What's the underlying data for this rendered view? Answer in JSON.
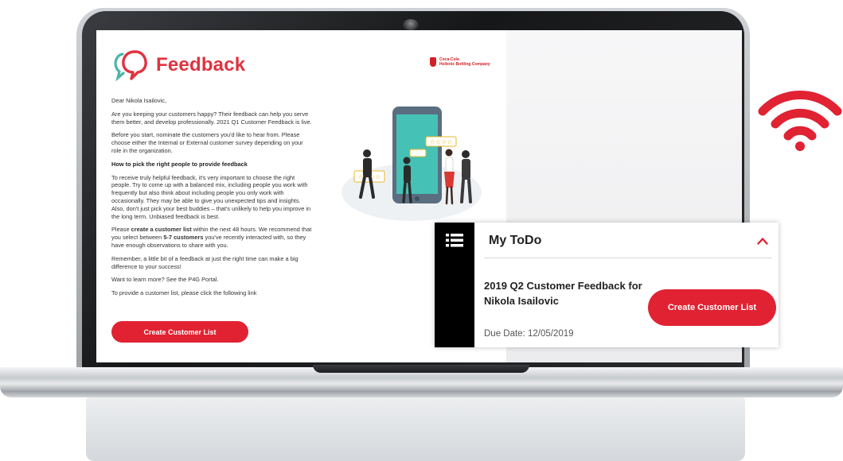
{
  "colors": {
    "brand_red": "#e02232",
    "logo_teal": "#4bb6a8",
    "sidebar_black": "#000000"
  },
  "email": {
    "brand_name": "Feedback",
    "brand_icon": "speech-bubbles-icon",
    "company": {
      "line1": "Coca-Cola",
      "line2": "Hellenic Bottling Company"
    },
    "greeting": "Dear Nikola Isailovic,",
    "paragraph1": "Are you keeping your customers happy? Their feedback can help you serve them better, and develop professionally. 2021 Q1 Customer Feedback is live.",
    "paragraph2": "Before you start, nominate the customers you'd like to hear from. Please choose either the Internal or External customer survey depending on your role in the organization.",
    "heading": "How to pick the right people to provide feedback",
    "paragraph3": "To receive truly helpful feedback, it's very important to choose the right people. Try to come up with a balanced mix, including people you work with frequently but also think about including people you only work with occasionally. They may be able to give you unexpected tips and insights. Also, don't just pick your best buddies – that's unlikely to help you improve in the long term. Unbiased feedback is best.",
    "paragraph4": {
      "part1": "Please ",
      "bold1": "create a customer list",
      "part2": " within the next 48 hours. We recommend that you select between ",
      "bold2": "5-7 customers",
      "part3": " you've recently interacted with, so they have enough observations to share with you."
    },
    "paragraph5": "Remember, a little bit of a feedback at just the right time can make a big difference to your success!",
    "paragraph6": "Want to learn more? See the P4G Portal.",
    "paragraph7": "To provide a customer list, please click the following link",
    "cta_label": "Create Customer List"
  },
  "todo": {
    "menu_icon": "hamburger-menu-icon",
    "title": "My ToDo",
    "collapse_icon": "chevron-up-icon",
    "item_title": "2019 Q2 Customer Feedback for Nikola Isailovic",
    "due_date": "Due Date: 12/05/2019",
    "cta_label": "Create Customer List"
  },
  "decor": {
    "wifi_icon": "wifi-icon"
  }
}
